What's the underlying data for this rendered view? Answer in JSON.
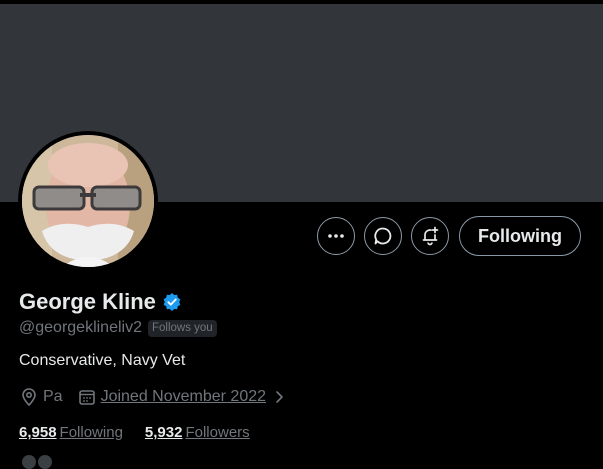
{
  "profile": {
    "name": "George Kline",
    "handle": "@georgeklineliv2",
    "follows_you_badge": "Follows you",
    "bio": "Conservative, Navy Vet",
    "location": "Pa",
    "joined": "Joined November 2022",
    "following_count": "6,958",
    "following_label": "Following",
    "followers_count": "5,932",
    "followers_label": "Followers",
    "verified": true
  },
  "actions": {
    "more_icon": "more-horizontal-icon",
    "message_icon": "message-bubble-icon",
    "notify_icon": "bell-plus-icon",
    "follow_label": "Following"
  },
  "colors": {
    "background": "#000000",
    "banner": "#32363a",
    "verified_badge": "#1d9bf0",
    "text_primary": "#e7e9ea",
    "text_secondary": "#71767b",
    "button_border": "#8b98a5"
  }
}
